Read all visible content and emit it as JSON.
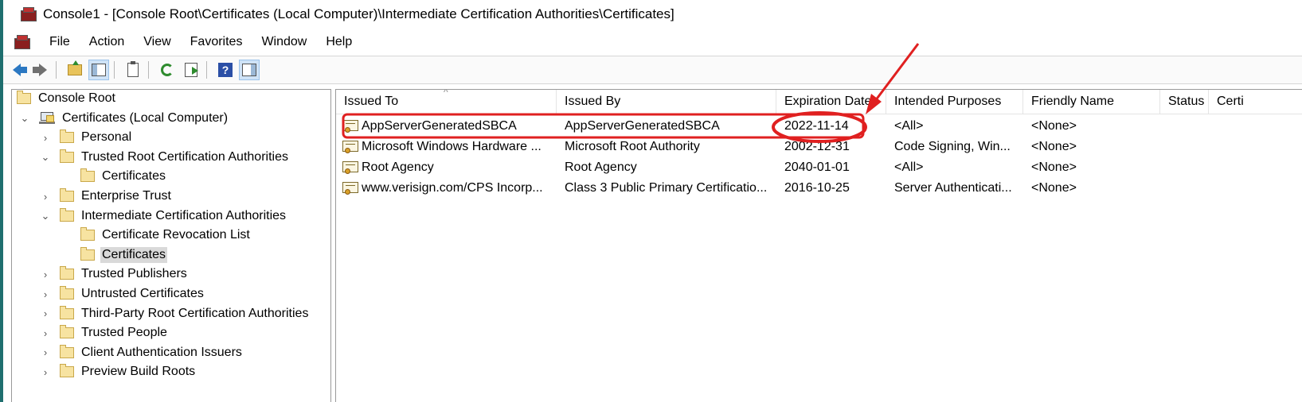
{
  "window": {
    "title": "Console1 - [Console Root\\Certificates (Local Computer)\\Intermediate Certification Authorities\\Certificates]"
  },
  "menu": [
    "File",
    "Action",
    "View",
    "Favorites",
    "Window",
    "Help"
  ],
  "toolbar": {
    "icons": [
      "back-arrow-icon",
      "forward-arrow-icon",
      "up-folder-icon",
      "show-hide-tree-icon",
      "properties-icon",
      "refresh-icon",
      "export-list-icon",
      "help-icon",
      "show-action-pane-icon"
    ],
    "help_glyph": "?"
  },
  "tree": {
    "items": [
      {
        "label": "Console Root",
        "level": 0,
        "chevron": "",
        "icon": "folder"
      },
      {
        "label": "Certificates (Local Computer)",
        "level": 0,
        "chevron": "⌄",
        "icon": "computer"
      },
      {
        "label": "Personal",
        "level": 1,
        "chevron": "›",
        "icon": "folder"
      },
      {
        "label": "Trusted Root Certification Authorities",
        "level": 1,
        "chevron": "⌄",
        "icon": "folder"
      },
      {
        "label": "Certificates",
        "level": 2,
        "chevron": "",
        "icon": "folder"
      },
      {
        "label": "Enterprise Trust",
        "level": 1,
        "chevron": "›",
        "icon": "folder"
      },
      {
        "label": "Intermediate Certification Authorities",
        "level": 1,
        "chevron": "⌄",
        "icon": "folder"
      },
      {
        "label": "Certificate Revocation List",
        "level": 2,
        "chevron": "",
        "icon": "folder"
      },
      {
        "label": "Certificates",
        "level": 2,
        "chevron": "",
        "icon": "folder",
        "selected": true
      },
      {
        "label": "Trusted Publishers",
        "level": 1,
        "chevron": "›",
        "icon": "folder"
      },
      {
        "label": "Untrusted Certificates",
        "level": 1,
        "chevron": "›",
        "icon": "folder"
      },
      {
        "label": "Third-Party Root Certification Authorities",
        "level": 1,
        "chevron": "›",
        "icon": "folder"
      },
      {
        "label": "Trusted People",
        "level": 1,
        "chevron": "›",
        "icon": "folder"
      },
      {
        "label": "Client Authentication Issuers",
        "level": 1,
        "chevron": "›",
        "icon": "folder"
      },
      {
        "label": "Preview Build Roots",
        "level": 1,
        "chevron": "›",
        "icon": "folder"
      }
    ]
  },
  "list": {
    "sort_caret": "^",
    "columns": [
      "Issued To",
      "Issued By",
      "Expiration Date",
      "Intended Purposes",
      "Friendly Name",
      "Status",
      "Certi"
    ],
    "rows": [
      [
        "AppServerGeneratedSBCA",
        "AppServerGeneratedSBCA",
        "2022-11-14",
        "<All>",
        "<None>"
      ],
      [
        "Microsoft Windows Hardware ...",
        "Microsoft Root Authority",
        "2002-12-31",
        "Code Signing, Win...",
        "<None>"
      ],
      [
        "Root Agency",
        "Root Agency",
        "2040-01-01",
        "<All>",
        "<None>"
      ],
      [
        "www.verisign.com/CPS Incorp...",
        "Class 3 Public Primary Certificatio...",
        "2016-10-25",
        "Server Authenticati...",
        "<None>"
      ]
    ]
  },
  "annotation_color": "#e02020"
}
